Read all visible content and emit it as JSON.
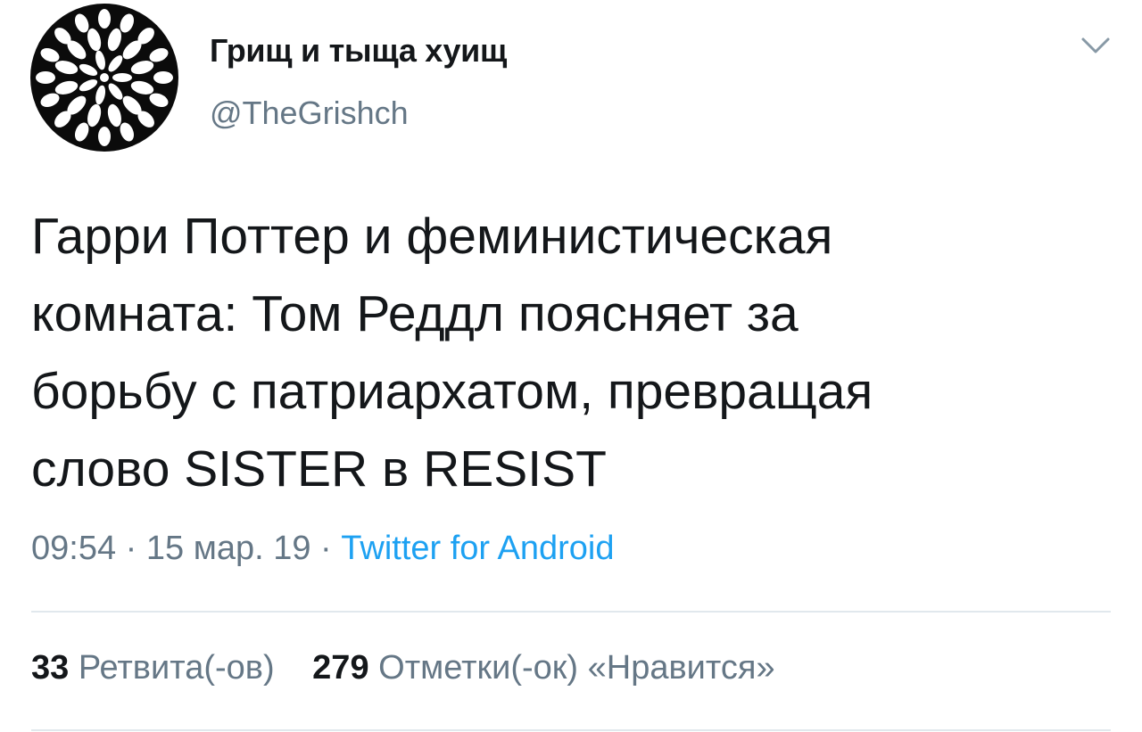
{
  "user": {
    "display_name": "Грищ и тыща хуищ",
    "handle": "@TheGrishch",
    "avatar_icon": "flower-avatar-icon"
  },
  "tweet": {
    "text": "Гарри Поттер и феминистическая\nкомната: Том Реддл поясняет за\nборьбу с патриархатом, превращая\nслово SISTER в RESIST",
    "time": "09:54",
    "separator": "·",
    "date": "15 мар. 19",
    "source": "Twitter for Android"
  },
  "stats": {
    "retweets_count": "33",
    "retweets_label": "Ретвита(-ов)",
    "likes_count": "279",
    "likes_label": "Отметки(-ок) «Нравится»"
  },
  "colors": {
    "text": "#14171a",
    "secondary": "#657786",
    "link": "#1da1f2",
    "divider": "#e1e8ed"
  },
  "icons": {
    "menu_caret": "chevron-down-icon"
  }
}
